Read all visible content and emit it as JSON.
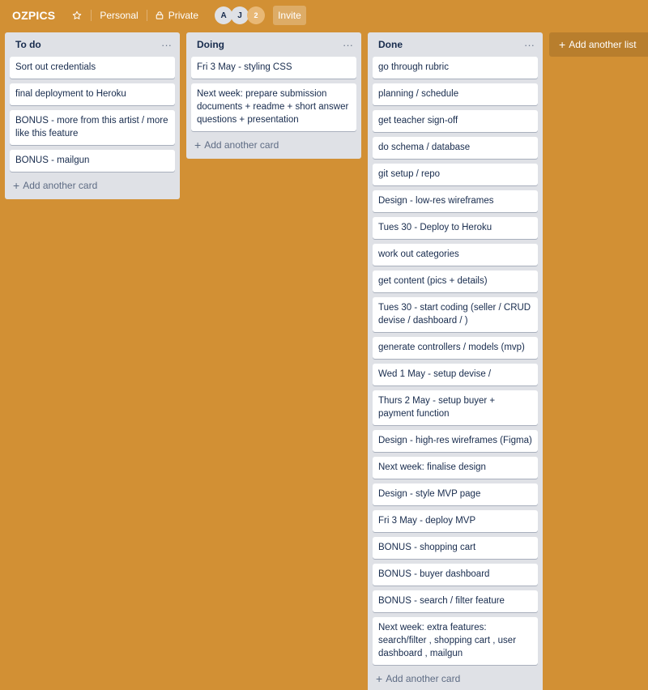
{
  "board": {
    "title": "OZPICS",
    "team": "Personal",
    "visibility": "Private",
    "members": [
      "A",
      "J"
    ],
    "member_count": "2",
    "invite_label": "Invite",
    "star_icon": "star-icon",
    "lock_icon": "lock-icon"
  },
  "lists": [
    {
      "title": "To do",
      "cards": [
        "Sort out credentials",
        "final deployment to Heroku",
        "BONUS - more from this artist / more like this feature",
        "BONUS - mailgun"
      ],
      "add_card_label": "Add another card"
    },
    {
      "title": "Doing",
      "cards": [
        "Fri 3 May - styling CSS",
        "Next week: prepare submission documents + readme + short answer questions + presentation"
      ],
      "add_card_label": "Add another card"
    },
    {
      "title": "Done",
      "cards": [
        "go through rubric",
        "planning / schedule",
        "get teacher sign-off",
        "do schema / database",
        "git setup / repo",
        "Design - low-res wireframes",
        "Tues 30 - Deploy to Heroku",
        "work out categories",
        "get content (pics + details)",
        "Tues 30 - start coding (seller / CRUD devise / dashboard / )",
        "generate controllers / models (mvp)",
        "Wed 1 May - setup devise /",
        "Thurs 2 May - setup buyer + payment function",
        "Design - high-res wireframes (Figma)",
        "Next week: finalise design",
        "Design - style MVP page",
        "Fri 3 May - deploy MVP",
        "BONUS - shopping cart",
        "BONUS - buyer dashboard",
        "BONUS - search / filter feature",
        "Next week: extra features: search/filter , shopping cart , user dashboard , mailgun"
      ],
      "add_card_label": "Add another card"
    }
  ],
  "add_list_label": "Add another list",
  "menu_glyph": "···",
  "plus_glyph": "+",
  "colors": {
    "board_background": "#d29034",
    "list_background": "#dfe1e6",
    "card_background": "#ffffff"
  }
}
